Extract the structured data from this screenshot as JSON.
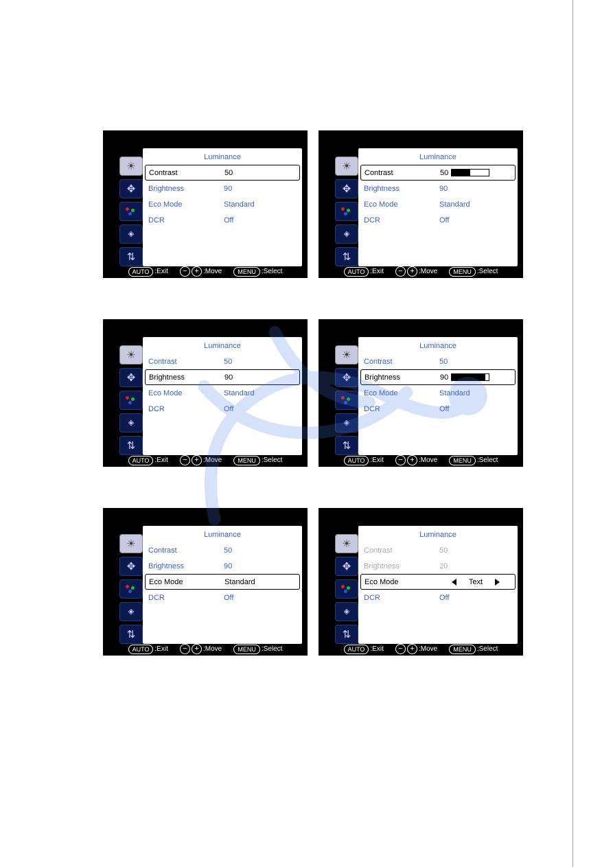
{
  "panels": [
    {
      "title": "Luminance",
      "items": [
        {
          "label": "Contrast",
          "value": "50",
          "selected": true
        },
        {
          "label": "Brightness",
          "value": "90"
        },
        {
          "label": "Eco Mode",
          "value": "Standard"
        },
        {
          "label": "DCR",
          "value": "Off"
        }
      ]
    },
    {
      "title": "Luminance",
      "items": [
        {
          "label": "Contrast",
          "value": "50",
          "selected": true,
          "bar": 50
        },
        {
          "label": "Brightness",
          "value": "90"
        },
        {
          "label": "Eco Mode",
          "value": "Standard"
        },
        {
          "label": "DCR",
          "value": "Off"
        }
      ]
    },
    {
      "title": "Luminance",
      "items": [
        {
          "label": "Contrast",
          "value": "50"
        },
        {
          "label": "Brightness",
          "value": "90",
          "selected": true
        },
        {
          "label": "Eco Mode",
          "value": "Standard"
        },
        {
          "label": "DCR",
          "value": "Off"
        }
      ]
    },
    {
      "title": "Luminance",
      "items": [
        {
          "label": "Contrast",
          "value": "50"
        },
        {
          "label": "Brightness",
          "value": "90",
          "selected": true,
          "bar": 90
        },
        {
          "label": "Eco Mode",
          "value": "Standard"
        },
        {
          "label": "DCR",
          "value": "Off"
        }
      ]
    },
    {
      "title": "Luminance",
      "items": [
        {
          "label": "Contrast",
          "value": "50"
        },
        {
          "label": "Brightness",
          "value": "90"
        },
        {
          "label": "Eco Mode",
          "value": "Standard",
          "selected": true
        },
        {
          "label": "DCR",
          "value": "Off"
        }
      ]
    },
    {
      "title": "Luminance",
      "items": [
        {
          "label": "Contrast",
          "value": "50",
          "dimmed": true
        },
        {
          "label": "Brightness",
          "value": "20",
          "dimmed": true
        },
        {
          "label": "Eco Mode",
          "value": "Text",
          "selected": true,
          "arrows": true
        },
        {
          "label": "DCR",
          "value": "Off"
        }
      ]
    }
  ],
  "footer": {
    "auto": "AUTO",
    "exit": ":Exit",
    "move": ":Move",
    "menu": "MENU",
    "select": ":Select"
  },
  "sidebar_icons": [
    "luminance-icon",
    "image-setup-icon",
    "color-setup-icon",
    "osd-setup-icon",
    "extra-icon"
  ]
}
